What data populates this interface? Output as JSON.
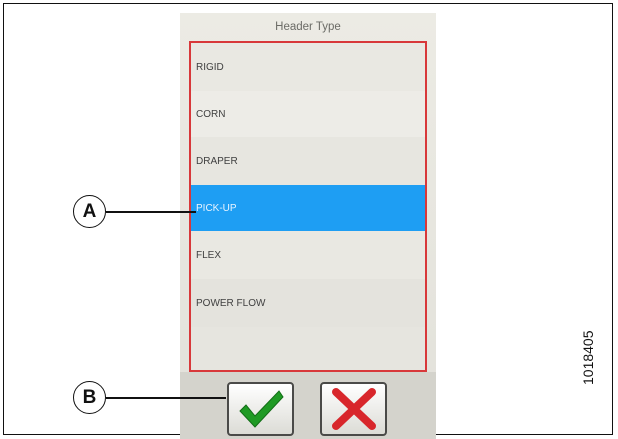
{
  "screen": {
    "title": "Header Type",
    "items": [
      {
        "label": "RIGID",
        "selected": false
      },
      {
        "label": "CORN",
        "selected": false
      },
      {
        "label": "DRAPER",
        "selected": false
      },
      {
        "label": "PICK-UP",
        "selected": true
      },
      {
        "label": "FLEX",
        "selected": false
      },
      {
        "label": "POWER FLOW",
        "selected": false
      },
      {
        "label": "",
        "selected": false
      }
    ],
    "confirm_icon": "check-icon",
    "cancel_icon": "x-icon"
  },
  "callouts": {
    "a_label": "A",
    "b_label": "B"
  },
  "figure_id": "1018405",
  "colors": {
    "selection": "#1e9ef3",
    "list_border": "#d8383a",
    "confirm": "#1f9a24",
    "cancel": "#d8262b"
  }
}
